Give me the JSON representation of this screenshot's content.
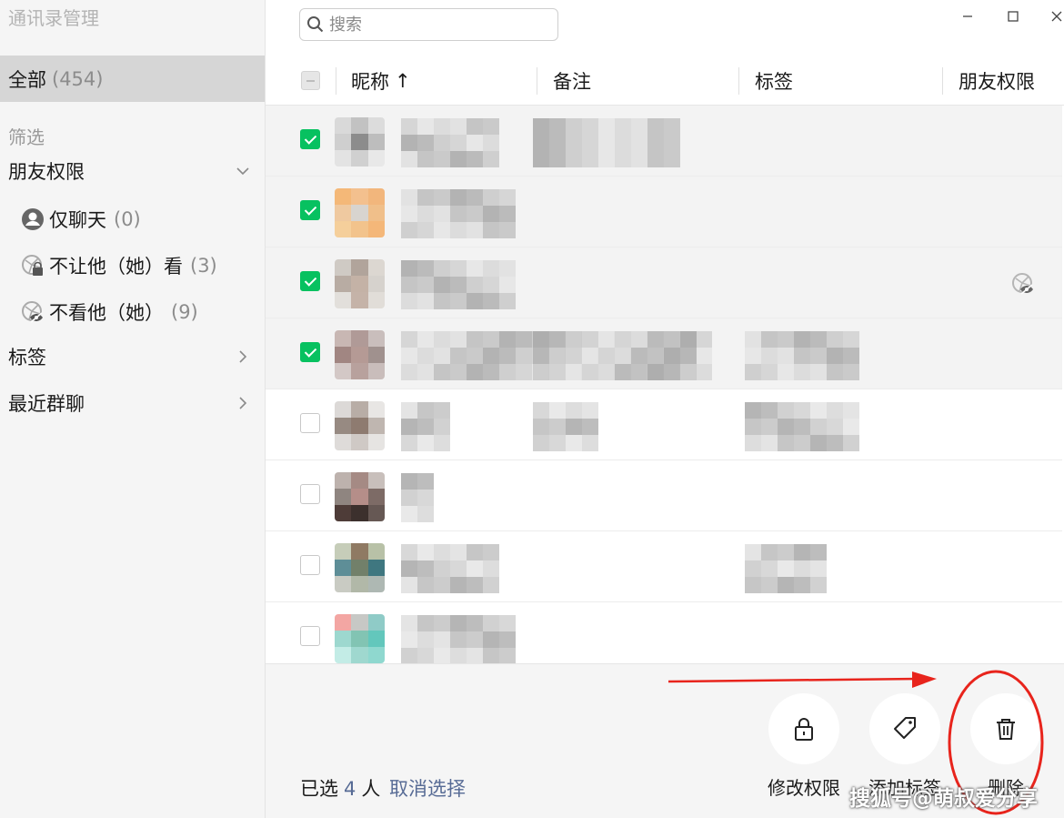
{
  "app": {
    "title": "通讯录管理"
  },
  "sidebar": {
    "all": {
      "label": "全部",
      "count": "(454)"
    },
    "filter_label": "筛选",
    "friend_permission": {
      "label": "朋友权限",
      "items": [
        {
          "label": "仅聊天",
          "count": "(0)",
          "icon": "chat-only-icon"
        },
        {
          "label": "不让他（她）看",
          "count": "(3)",
          "icon": "lock-moments-icon"
        },
        {
          "label": "不看他（她）",
          "count": "(9)",
          "icon": "hide-moments-icon"
        }
      ]
    },
    "tags": {
      "label": "标签"
    },
    "recent_groups": {
      "label": "最近群聊"
    }
  },
  "search": {
    "placeholder": "搜索"
  },
  "table": {
    "columns": {
      "nickname": "昵称",
      "sort_arrow": "↑",
      "remark": "备注",
      "tags": "标签",
      "permission": "朋友权限"
    },
    "rows": [
      {
        "checked": true
      },
      {
        "checked": true
      },
      {
        "checked": true,
        "permission_icon": "hide-moments-icon"
      },
      {
        "checked": true
      },
      {
        "checked": false
      },
      {
        "checked": false
      },
      {
        "checked": false
      },
      {
        "checked": false
      }
    ]
  },
  "footer": {
    "selected_prefix": "已选",
    "selected_count": "4",
    "selected_suffix": "人",
    "cancel_selection": "取消选择",
    "actions": {
      "modify_permission": "修改权限",
      "add_tag": "添加标签",
      "delete": "删除"
    }
  },
  "watermark": "搜狐号@萌叔爱分享",
  "colors": {
    "check_green": "#07c160",
    "link_blue": "#576b95",
    "annotation_red": "#e8241c"
  }
}
